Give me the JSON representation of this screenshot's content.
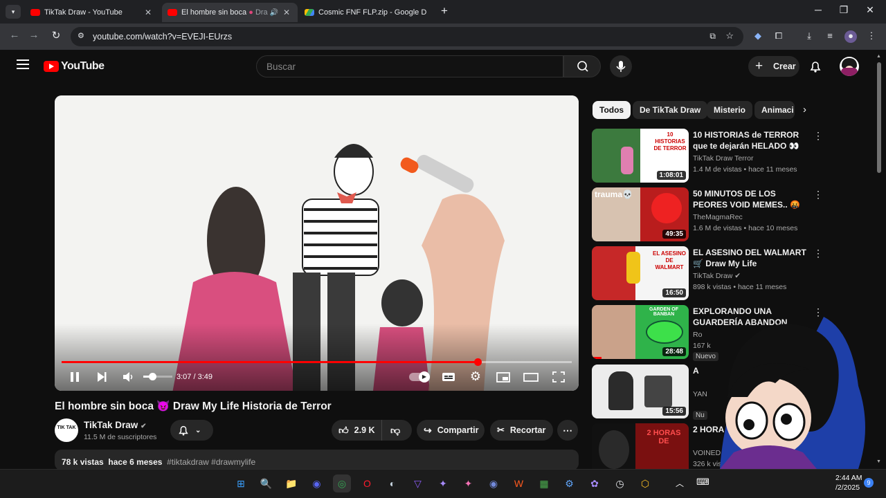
{
  "browser": {
    "tabs": [
      {
        "title": "TikTak Draw - YouTube",
        "favicon_color": "#ff0000",
        "active": false
      },
      {
        "title": "El hombre sin boca",
        "title_rest": "Dra",
        "favicon_color": "#ff0000",
        "active": true
      },
      {
        "title": "Cosmic FNF FLP.zip - Google D",
        "favicon_color": "#34a853",
        "active": false
      }
    ],
    "url": "youtube.com/watch?v=EVEJI-EUrzs",
    "window_controls": {
      "minimize": "─",
      "restore": "❐",
      "close": "✕"
    },
    "new_tab": "+"
  },
  "youtube": {
    "logo_text": "YouTube",
    "search_placeholder": "Buscar",
    "create_label": "Crear",
    "player": {
      "time": "3:07 / 3:49",
      "progress": 0.816,
      "volume": 0.3
    },
    "video_title": "El hombre sin boca 😈 Draw My Life Historia de Terror",
    "channel": {
      "name": "TikTak Draw",
      "subs": "11.5 M de suscriptores",
      "avatar_text": "TIK TAK"
    },
    "likes": "2.9 K",
    "share_label": "Compartir",
    "clip_label": "Recortar",
    "description": {
      "views": "78 k vistas",
      "age": "hace 6 meses",
      "tags": "#tiktakdraw #drawmylife"
    },
    "chips": [
      "Todos",
      "De TikTak Draw",
      "Misterio",
      "Animaci"
    ],
    "recommendations": [
      {
        "title": "10 HISTORIAS de TERROR que te dejarán HELADO 👀 Draw ...",
        "channel": "TikTak Draw Terror",
        "meta": "1.4 M de vistas • hace 11 meses",
        "duration": "1:08:01",
        "thumb_text": "10 HISTORIAS DE TERROR",
        "thumb_color": "#3c7a3e"
      },
      {
        "title": "50 MINUTOS DE LOS PEORES VOID MEMES.. 🤬 💀",
        "channel": "TheMagmaRec",
        "meta": "1.6 M de vistas • hace 10 meses",
        "duration": "49:35",
        "thumb_text": "trauma💀",
        "thumb_color": "#b91d1d"
      },
      {
        "title": "EL ASESINO DEL WALMART 🛒 Draw My Life",
        "channel": "TikTak Draw",
        "meta": "898 k vistas • hace 11 meses",
        "duration": "16:50",
        "thumb_text": "EL ASESINO DE WALMART",
        "thumb_color": "#c8b27a"
      },
      {
        "title": "EXPLORANDO UNA GUARDERÍA ABANDON",
        "channel": "Ro",
        "meta": "167 k",
        "duration": "28:48",
        "badge": "Nuevo",
        "thumb_text": "GARDEN OF BANBAN",
        "thumb_color": "#2fb34a"
      },
      {
        "title": "A",
        "channel": "YAN",
        "meta": "",
        "duration": "15:56",
        "badge": "Nu",
        "thumb_text": "",
        "thumb_color": "#e9e9e9"
      },
      {
        "title": "2 HORA VOIID M",
        "channel": "VOINED",
        "meta": "326 k vistas",
        "duration": "",
        "thumb_text": "2 HORAS DE",
        "thumb_color": "#7a1010"
      }
    ]
  },
  "taskbar": {
    "icons": [
      {
        "name": "windows-start-icon",
        "glyph": "⊞",
        "color": "#3aa0ff"
      },
      {
        "name": "search-taskbar-icon",
        "glyph": "🔍",
        "color": "#ff9b2f"
      },
      {
        "name": "file-explorer-icon",
        "glyph": "📁",
        "color": "#f5c242"
      },
      {
        "name": "discord-icon",
        "glyph": "◉",
        "color": "#5865f2"
      },
      {
        "name": "chrome-icon",
        "glyph": "◎",
        "color": "#34a853"
      },
      {
        "name": "opera-icon",
        "glyph": "O",
        "color": "#ff1b2d"
      },
      {
        "name": "steam-icon",
        "glyph": "◐",
        "color": "#c7d5e0"
      },
      {
        "name": "vpn-icon",
        "glyph": "▽",
        "color": "#8b5cf6"
      },
      {
        "name": "sparkle-app-icon",
        "glyph": "✦",
        "color": "#a78bfa"
      },
      {
        "name": "sparkle-app-2-icon",
        "glyph": "✦",
        "color": "#f472b6"
      },
      {
        "name": "discord-2-icon",
        "glyph": "◉",
        "color": "#7289da"
      },
      {
        "name": "w-app-icon",
        "glyph": "W",
        "color": "#ff5a1f"
      },
      {
        "name": "minecraft-icon",
        "glyph": "▦",
        "color": "#4caf50"
      },
      {
        "name": "settings-taskbar-icon",
        "glyph": "⚙",
        "color": "#60a5fa"
      },
      {
        "name": "chat-icon",
        "glyph": "✿",
        "color": "#a78bfa"
      },
      {
        "name": "clock-app-icon",
        "glyph": "◷",
        "color": "#e5e7eb"
      },
      {
        "name": "shield-app-icon",
        "glyph": "⬡",
        "color": "#fbbf24"
      }
    ],
    "time": "2:44 AM",
    "date": "/2/2025",
    "notif_count": "9"
  }
}
